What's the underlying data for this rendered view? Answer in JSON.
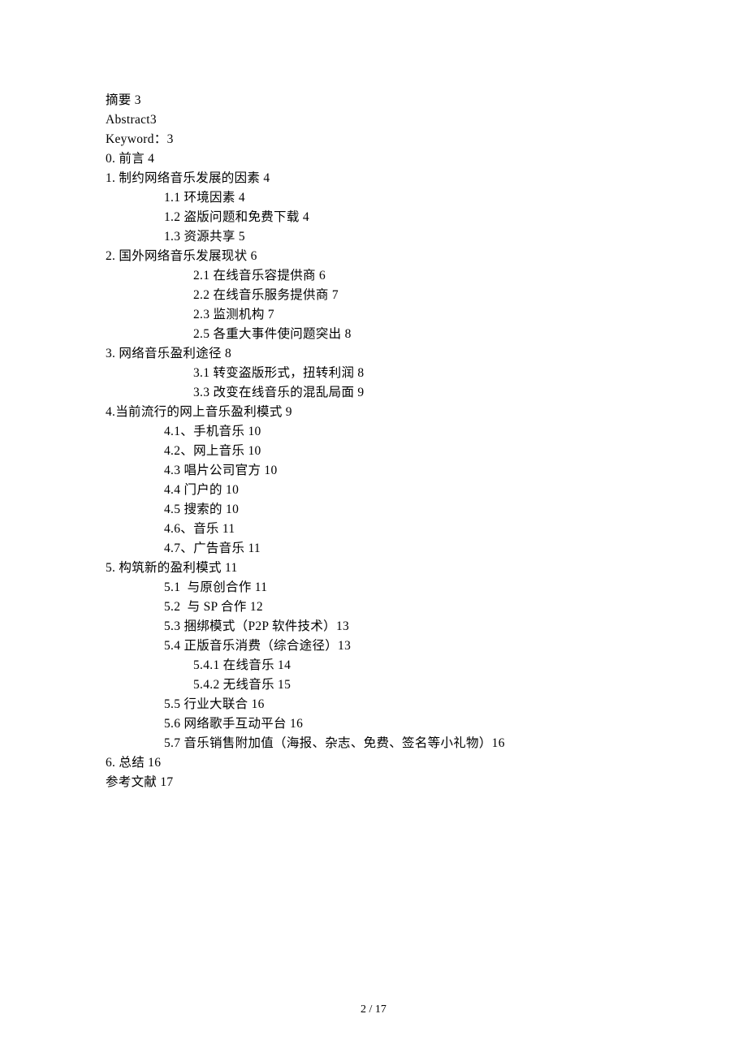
{
  "toc": {
    "abstract_zh": "摘要 3",
    "abstract_en": "Abstract3",
    "keyword": "Keyword：3",
    "preface": "0. 前言 4",
    "s1": "1. 制约网络音乐发展的因素 4",
    "s1_1": "1.1 环境因素 4",
    "s1_2": "1.2 盗版问题和免费下载 4",
    "s1_3": "1.3 资源共享 5",
    "s2": "2. 国外网络音乐发展现状 6",
    "s2_1": "2.1 在线音乐容提供商 6",
    "s2_2": "2.2 在线音乐服务提供商 7",
    "s2_3": "2.3 监测机构 7",
    "s2_5": "2.5 各重大事件使问题突出 8",
    "s3": "3. 网络音乐盈利途径 8",
    "s3_1": "3.1 转变盗版形式，扭转利润 8",
    "s3_3": "3.3 改变在线音乐的混乱局面 9",
    "s4": "4.当前流行的网上音乐盈利模式 9",
    "s4_1": "4.1、手机音乐 10",
    "s4_2": "4.2、网上音乐 10",
    "s4_3": "4.3 唱片公司官方 10",
    "s4_4": "4.4 门户的 10",
    "s4_5": "4.5 搜索的 10",
    "s4_6": "4.6、音乐 11",
    "s4_7": "4.7、广告音乐 11",
    "s5": "5. 构筑新的盈利模式 11",
    "s5_1": "5.1  与原创合作 11",
    "s5_2": "5.2  与 SP 合作 12",
    "s5_3": "5.3 捆绑模式（P2P 软件技术）13",
    "s5_4": "5.4 正版音乐消费（综合途径）13",
    "s5_4_1": "5.4.1 在线音乐 14",
    "s5_4_2": "5.4.2 无线音乐 15",
    "s5_5": "5.5 行业大联合 16",
    "s5_6": "5.6 网络歌手互动平台 16",
    "s5_7": "5.7 音乐销售附加值（海报、杂志、免费、签名等小礼物）16",
    "s6": "6. 总结 16",
    "references": "参考文献 17"
  },
  "page_number": "2 / 17"
}
